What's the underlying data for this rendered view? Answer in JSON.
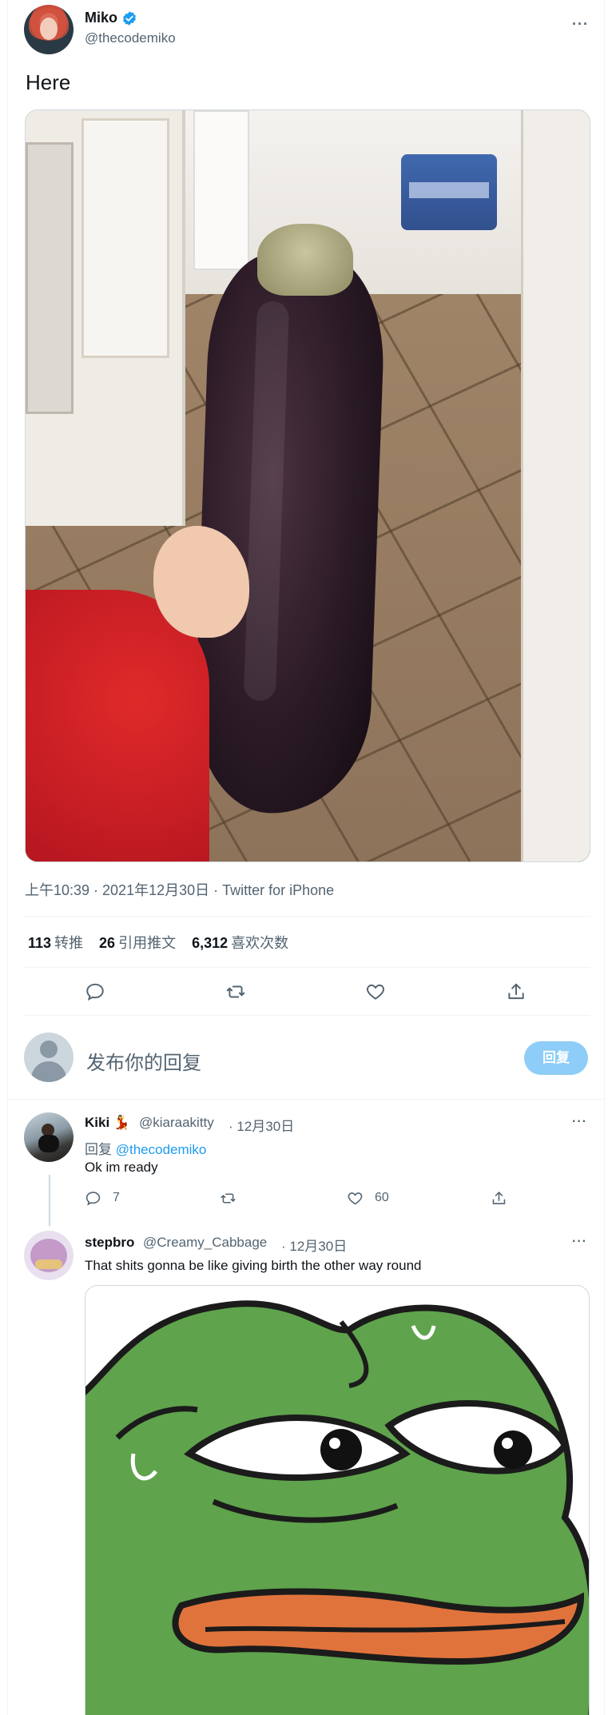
{
  "tweet": {
    "author": {
      "name": "Miko",
      "handle": "@thecodemiko"
    },
    "text": "Here",
    "meta": "上午10:39 · 2021年12月30日 · Twitter for iPhone",
    "stats": {
      "retweets_count": "113",
      "retweets_label": "转推",
      "quotes_count": "26",
      "quotes_label": "引用推文",
      "likes_count": "6,312",
      "likes_label": "喜欢次数"
    }
  },
  "icons": {
    "verified": "verified-badge-icon",
    "more": "more-dots-icon",
    "reply": "reply-icon",
    "retweet": "retweet-icon",
    "like": "heart-icon",
    "share": "share-icon"
  },
  "colors": {
    "accent": "#1d9bf0",
    "reply_button": "#8ecdf7",
    "muted": "#536471"
  },
  "composer": {
    "placeholder": "发布你的回复",
    "button_label": "回复"
  },
  "replies": [
    {
      "name": "Kiki 💃",
      "handle": "@kiaraakitty",
      "date": "· 12月30日",
      "reply_to_prefix": "回复",
      "reply_to_handle": "@thecodemiko",
      "text": "Ok im ready",
      "reply_count": "7",
      "like_count": "60"
    },
    {
      "name": "stepbro",
      "handle": "@Creamy_Cabbage",
      "date": "· 12月30日",
      "text": "That shits gonna be like giving birth the other way round"
    }
  ]
}
